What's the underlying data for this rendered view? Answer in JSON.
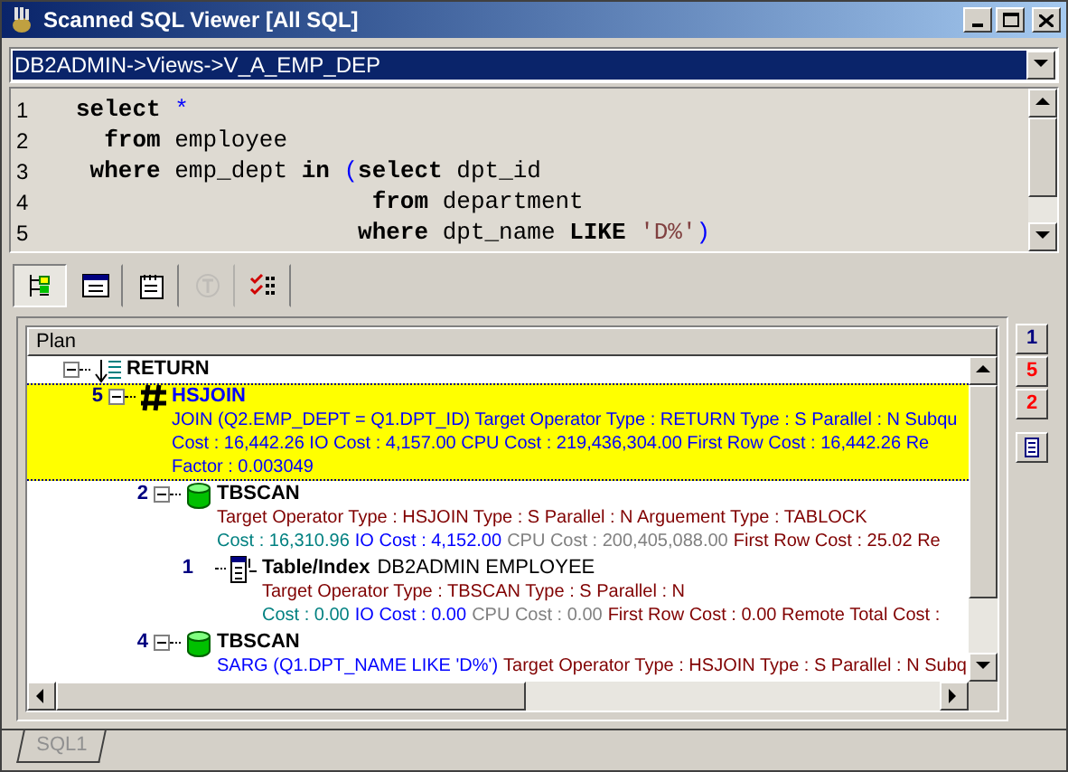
{
  "window": {
    "title": "Scanned SQL Viewer [All SQL]"
  },
  "object_path": {
    "value": "DB2ADMIN->Views->V_A_EMP_DEP"
  },
  "sql_lines": [
    {
      "number": "1",
      "tokens": [
        {
          "kind": "keyword",
          "text": "select"
        },
        {
          "kind": "symbol",
          "text": " *"
        }
      ]
    },
    {
      "number": "2",
      "tokens": [
        {
          "kind": "keyword",
          "text": "  from"
        },
        {
          "kind": "plain",
          "text": " employee"
        }
      ]
    },
    {
      "number": "3",
      "tokens": [
        {
          "kind": "keyword",
          "text": " where"
        },
        {
          "kind": "plain",
          "text": " emp_dept "
        },
        {
          "kind": "keyword",
          "text": "in"
        },
        {
          "kind": "symbol",
          "text": " ("
        },
        {
          "kind": "keyword",
          "text": "select"
        },
        {
          "kind": "plain",
          "text": " dpt_id"
        }
      ]
    },
    {
      "number": "4",
      "tokens": [
        {
          "kind": "keyword",
          "text": "                     from"
        },
        {
          "kind": "plain",
          "text": " department"
        }
      ]
    },
    {
      "number": "5",
      "tokens": [
        {
          "kind": "keyword",
          "text": "                    where"
        },
        {
          "kind": "plain",
          "text": " dpt_name "
        },
        {
          "kind": "keyword",
          "text": "LIKE"
        },
        {
          "kind": "string",
          "text": " 'D%'"
        },
        {
          "kind": "symbol",
          "text": ")"
        }
      ]
    }
  ],
  "toolbar": [
    {
      "kind": "plan-tree",
      "selected": true,
      "disabled": false
    },
    {
      "kind": "statement",
      "selected": false,
      "disabled": false
    },
    {
      "kind": "report",
      "selected": false,
      "disabled": false
    },
    {
      "kind": "text",
      "selected": false,
      "disabled": true
    },
    {
      "kind": "checklist",
      "selected": false,
      "disabled": false
    }
  ],
  "plan": {
    "header": "Plan",
    "nodes": [
      {
        "kind": "return",
        "title": "RETURN",
        "selected": false,
        "expanded": true,
        "children": [
          {
            "kind": "join",
            "number": "5",
            "title": "HSJOIN",
            "selected": true,
            "expanded": true,
            "lines": [
              [
                {
                  "kind": "predicate",
                  "text": "JOIN (Q2.EMP_DEPT = Q1.DPT_ID) Target Operator Type : RETURN Type : S Parallel : N Subqu"
                }
              ],
              [
                {
                  "kind": "predicate",
                  "text": "Cost : 16,442.26 IO Cost : 4,157.00 CPU Cost : 219,436,304.00 First Row Cost : 16,442.26 Re"
                }
              ],
              [
                {
                  "kind": "predicate",
                  "text": "Factor : 0.003049"
                }
              ]
            ],
            "children": [
              {
                "kind": "scan",
                "number": "2",
                "title": "TBSCAN",
                "selected": false,
                "expanded": true,
                "lines": [
                  [
                    {
                      "kind": "info",
                      "text": "Target Operator Type : HSJOIN Type : S Parallel : N Arguement Type : TABLOCK"
                    }
                  ],
                  [
                    {
                      "kind": "cost",
                      "text": "Cost : 16,310.96"
                    },
                    {
                      "kind": "io",
                      "text": "IO Cost : 4,152.00"
                    },
                    {
                      "kind": "cpu",
                      "text": "CPU Cost : 200,405,088.00"
                    },
                    {
                      "kind": "info",
                      "text": "First Row Cost : 25.02 Re"
                    }
                  ]
                ],
                "children": [
                  {
                    "kind": "table",
                    "number": "1",
                    "title": "Table/Index",
                    "name": "DB2ADMIN EMPLOYEE",
                    "selected": false,
                    "lines": [
                      [
                        {
                          "kind": "info",
                          "text": "Target Operator Type : TBSCAN Type : S Parallel : N"
                        }
                      ],
                      [
                        {
                          "kind": "cost",
                          "text": "Cost : 0.00"
                        },
                        {
                          "kind": "io",
                          "text": "IO Cost : 0.00"
                        },
                        {
                          "kind": "cpu",
                          "text": "CPU Cost : 0.00"
                        },
                        {
                          "kind": "info",
                          "text": "First Row Cost : 0.00 Remote Total Cost :"
                        }
                      ]
                    ]
                  }
                ]
              },
              {
                "kind": "scan",
                "number": "4",
                "title": "TBSCAN",
                "selected": false,
                "expanded": true,
                "lines": [
                  [
                    {
                      "kind": "predicate",
                      "text": "SARG (Q1.DPT_NAME LIKE 'D%')"
                    },
                    {
                      "kind": "info",
                      "text": "Target Operator Type : HSJOIN Type : S Parallel : N Subq"
                    }
                  ]
                ]
              }
            ]
          }
        ]
      }
    ]
  },
  "side_buttons": [
    {
      "kind": "digit",
      "label": "1"
    },
    {
      "kind": "step",
      "label": "5"
    },
    {
      "kind": "step",
      "label": "2"
    },
    {
      "kind": "list"
    }
  ],
  "tabs": [
    {
      "label": "SQL1",
      "selected": true
    }
  ]
}
